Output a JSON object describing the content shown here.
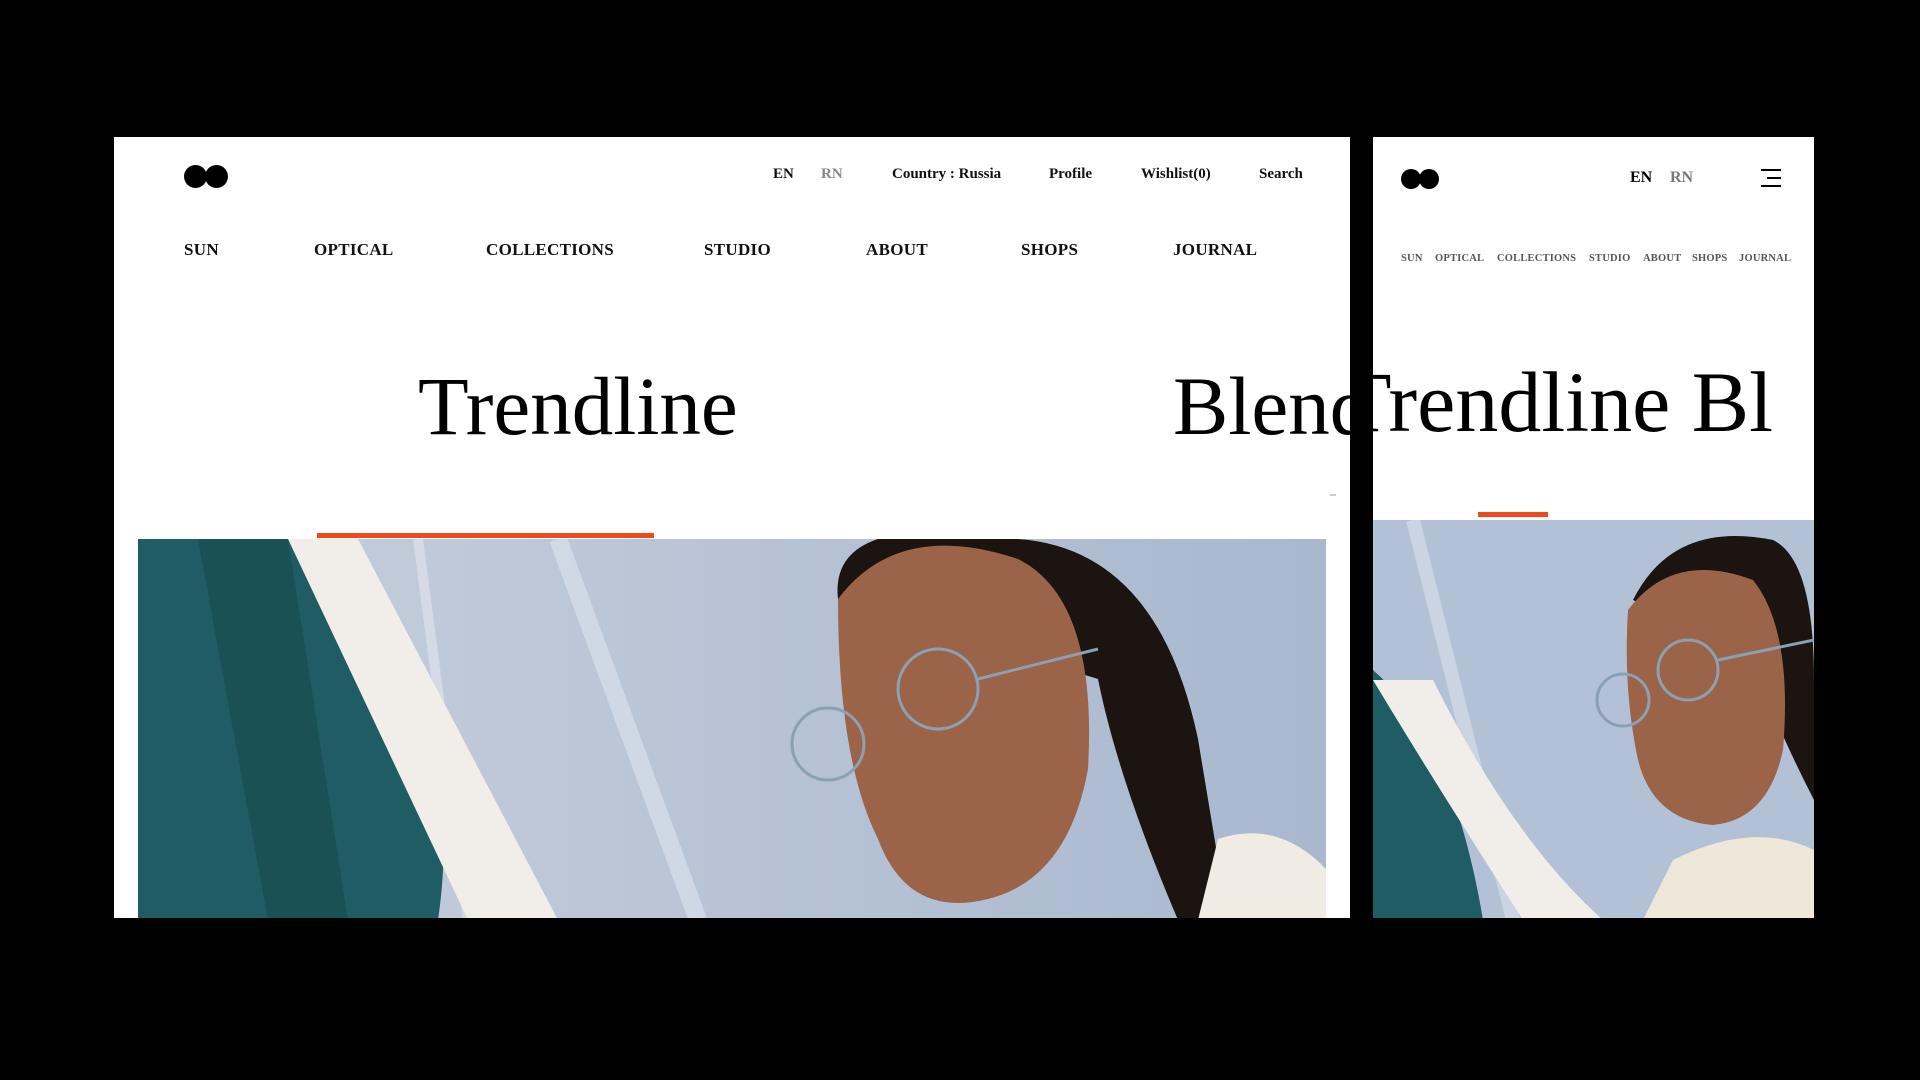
{
  "header": {
    "lang_en": "EN",
    "lang_rn": "RN",
    "country": "Country : Russia",
    "profile": "Profile",
    "wishlist": "Wishlist(0)",
    "search": "Search"
  },
  "nav": [
    "SUN",
    "OPTICAL",
    "COLLECTIONS",
    "STUDIO",
    "ABOUT",
    "SHOPS",
    "JOURNAL"
  ],
  "hero": {
    "title_1": "Trendline",
    "title_2": "Blend",
    "mobile_title": "Trendline Bl"
  },
  "colors": {
    "accent": "#ee4a1b",
    "photo_sky": "#b6c3d8",
    "teal_panel": "#1f5c63"
  },
  "icons": [
    "logo-icon",
    "menu-icon"
  ]
}
